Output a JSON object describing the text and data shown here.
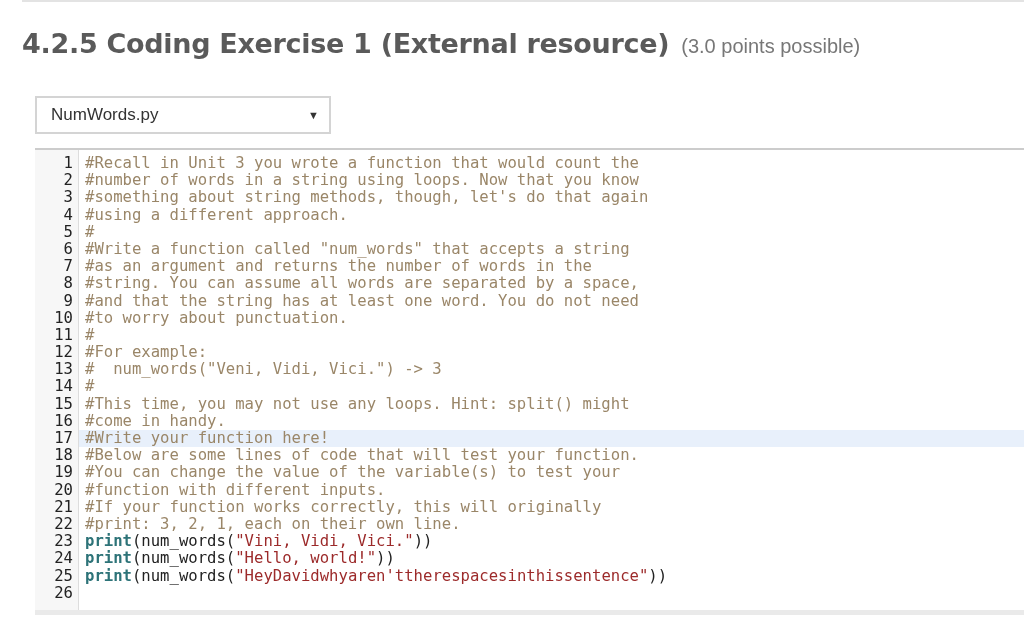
{
  "heading": {
    "title": "4.2.5 Coding Exercise 1 (External resource)",
    "points": "(3.0 points possible)"
  },
  "file_select": {
    "value": "NumWords.py",
    "caret": "▼"
  },
  "editor": {
    "lines": [
      {
        "number": "1",
        "active": false,
        "tokens": [
          {
            "kind": "comment",
            "text": "#Recall in Unit 3 you wrote a function that would count the"
          }
        ]
      },
      {
        "number": "2",
        "active": false,
        "tokens": [
          {
            "kind": "comment",
            "text": "#number of words in a string using loops. Now that you know"
          }
        ]
      },
      {
        "number": "3",
        "active": false,
        "tokens": [
          {
            "kind": "comment",
            "text": "#something about string methods, though, let's do that again"
          }
        ]
      },
      {
        "number": "4",
        "active": false,
        "tokens": [
          {
            "kind": "comment",
            "text": "#using a different approach."
          }
        ]
      },
      {
        "number": "5",
        "active": false,
        "tokens": [
          {
            "kind": "comment",
            "text": "#"
          }
        ]
      },
      {
        "number": "6",
        "active": false,
        "tokens": [
          {
            "kind": "comment",
            "text": "#Write a function called \"num_words\" that accepts a string"
          }
        ]
      },
      {
        "number": "7",
        "active": false,
        "tokens": [
          {
            "kind": "comment",
            "text": "#as an argument and returns the number of words in the"
          }
        ]
      },
      {
        "number": "8",
        "active": false,
        "tokens": [
          {
            "kind": "comment",
            "text": "#string. You can assume all words are separated by a space,"
          }
        ]
      },
      {
        "number": "9",
        "active": false,
        "tokens": [
          {
            "kind": "comment",
            "text": "#and that the string has at least one word. You do not need"
          }
        ]
      },
      {
        "number": "10",
        "active": false,
        "tokens": [
          {
            "kind": "comment",
            "text": "#to worry about punctuation."
          }
        ]
      },
      {
        "number": "11",
        "active": false,
        "tokens": [
          {
            "kind": "comment",
            "text": "#"
          }
        ]
      },
      {
        "number": "12",
        "active": false,
        "tokens": [
          {
            "kind": "comment",
            "text": "#For example:"
          }
        ]
      },
      {
        "number": "13",
        "active": false,
        "tokens": [
          {
            "kind": "comment",
            "text": "#  num_words(\"Veni, Vidi, Vici.\") -> 3"
          }
        ]
      },
      {
        "number": "14",
        "active": false,
        "tokens": [
          {
            "kind": "comment",
            "text": "#"
          }
        ]
      },
      {
        "number": "15",
        "active": false,
        "tokens": [
          {
            "kind": "comment",
            "text": "#This time, you may not use any loops. Hint: split() might"
          }
        ]
      },
      {
        "number": "16",
        "active": false,
        "tokens": [
          {
            "kind": "comment",
            "text": "#come in handy."
          }
        ]
      },
      {
        "number": "17",
        "active": true,
        "tokens": [
          {
            "kind": "comment",
            "text": "#Write your function here!"
          }
        ]
      },
      {
        "number": "18",
        "active": false,
        "tokens": [
          {
            "kind": "comment",
            "text": "#Below are some lines of code that will test your function."
          }
        ]
      },
      {
        "number": "19",
        "active": false,
        "tokens": [
          {
            "kind": "comment",
            "text": "#You can change the value of the variable(s) to test your"
          }
        ]
      },
      {
        "number": "20",
        "active": false,
        "tokens": [
          {
            "kind": "comment",
            "text": "#function with different inputs."
          }
        ]
      },
      {
        "number": "21",
        "active": false,
        "tokens": [
          {
            "kind": "comment",
            "text": "#If your function works correctly, this will originally"
          }
        ]
      },
      {
        "number": "22",
        "active": false,
        "tokens": [
          {
            "kind": "comment",
            "text": "#print: 3, 2, 1, each on their own line."
          }
        ]
      },
      {
        "number": "23",
        "active": false,
        "tokens": [
          {
            "kind": "keyword",
            "text": "print"
          },
          {
            "kind": "plain",
            "text": "(num_words("
          },
          {
            "kind": "string",
            "text": "\"Vini, Vidi, Vici.\""
          },
          {
            "kind": "plain",
            "text": "))"
          }
        ]
      },
      {
        "number": "24",
        "active": false,
        "tokens": [
          {
            "kind": "keyword",
            "text": "print"
          },
          {
            "kind": "plain",
            "text": "(num_words("
          },
          {
            "kind": "string",
            "text": "\"Hello, world!\""
          },
          {
            "kind": "plain",
            "text": "))"
          }
        ]
      },
      {
        "number": "25",
        "active": false,
        "tokens": [
          {
            "kind": "keyword",
            "text": "print"
          },
          {
            "kind": "plain",
            "text": "(num_words("
          },
          {
            "kind": "string",
            "text": "\"HeyDavidwhyaren'ttherespacesinthissentence\""
          },
          {
            "kind": "plain",
            "text": "))"
          }
        ]
      },
      {
        "number": "26",
        "active": false
      }
    ]
  }
}
